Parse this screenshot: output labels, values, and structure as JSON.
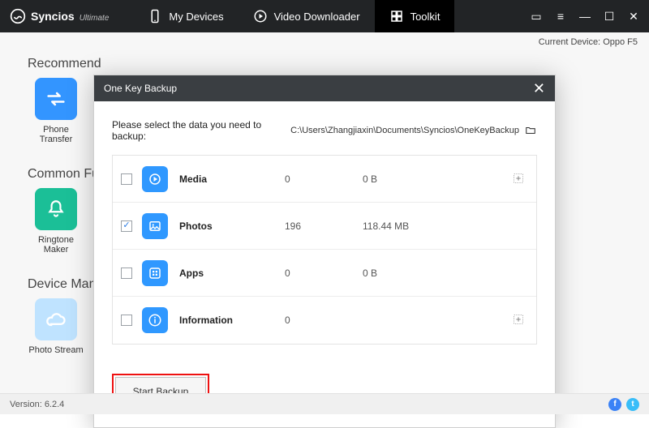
{
  "app": {
    "name": "Syncios",
    "edition": "Ultimate"
  },
  "nav": {
    "devices": "My Devices",
    "downloader": "Video Downloader",
    "toolkit": "Toolkit"
  },
  "device_label": "Current Device:",
  "device_name": "Oppo F5",
  "sections": {
    "s1": "Recommend",
    "s2": "Common Functions",
    "s3": "Device Management"
  },
  "tiles": {
    "transfer": "Phone Transfer",
    "ringtone": "Ringtone Maker",
    "photostream": "Photo Stream"
  },
  "modal": {
    "title": "One Key Backup",
    "prompt": "Please select the data you need to backup:",
    "path": "C:\\Users\\Zhangjiaxin\\Documents\\Syncios\\OneKeyBackup",
    "rows": [
      {
        "name": "Media",
        "count": "0",
        "size": "0 B",
        "checked": false,
        "opt": true
      },
      {
        "name": "Photos",
        "count": "196",
        "size": "118.44 MB",
        "checked": true,
        "opt": false
      },
      {
        "name": "Apps",
        "count": "0",
        "size": "0 B",
        "checked": false,
        "opt": false
      },
      {
        "name": "Information",
        "count": "0",
        "size": "",
        "checked": false,
        "opt": true
      }
    ],
    "start": "Start Backup"
  },
  "footer": {
    "version_label": "Version:",
    "version": "6.2.4"
  }
}
